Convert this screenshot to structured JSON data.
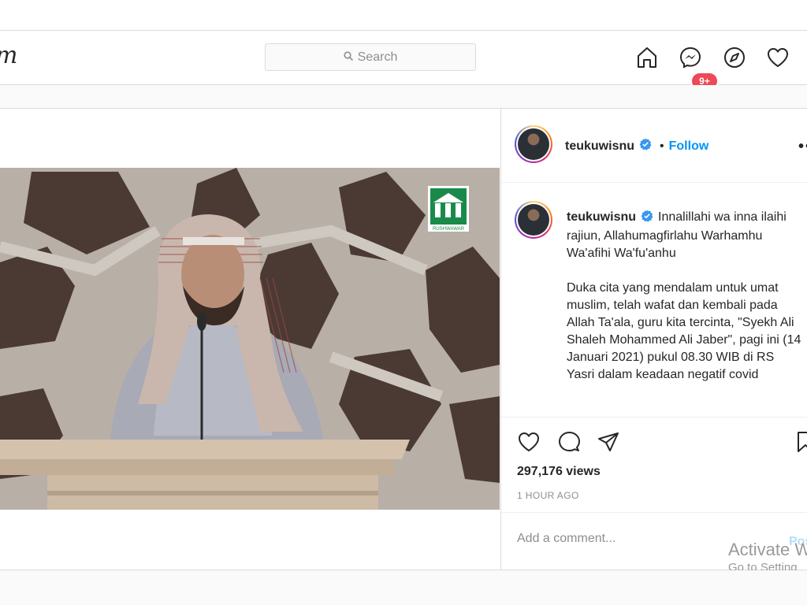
{
  "header": {
    "logo_fragment": "m",
    "search_placeholder": "Search",
    "badge_count": "9+"
  },
  "nav_icons": [
    "home-icon",
    "messenger-icon",
    "explore-compass-icon",
    "activity-heart-icon"
  ],
  "post": {
    "video": {
      "logo_label": "RUSHWAWAR",
      "sound_icon": "volume-icon"
    },
    "author": {
      "username": "teukuwisnu",
      "verified": true,
      "separator": "•",
      "follow_label": "Follow",
      "more_label": "••"
    },
    "caption": {
      "username": "teukuwisnu",
      "paragraph1": "Innalillahi wa inna ilaihi rajiun, Allahumagfirlahu Warhamhu Wa'afihi Wa'fu'anhu",
      "paragraph2": "Duka cita yang mendalam untuk umat muslim, telah wafat dan kembali pada Allah Ta'ala, guru kita tercinta, \"Syekh Ali Shaleh Mohammed Ali Jaber\", pagi ini (14 Januari 2021) pukul 08.30 WIB di RS Yasri dalam keadaan negatif covid"
    },
    "views": "297,176 views",
    "time": "1 HOUR AGO",
    "comment": {
      "placeholder": "Add a comment...",
      "post_label": "Post"
    }
  },
  "watermark": {
    "line1": "Activate W",
    "line2": "Go to Setting"
  },
  "colors": {
    "accent_blue": "#0095f6",
    "badge_red": "#ed4956",
    "border": "#dbdbdb",
    "muted_text": "#8e8e8e"
  }
}
